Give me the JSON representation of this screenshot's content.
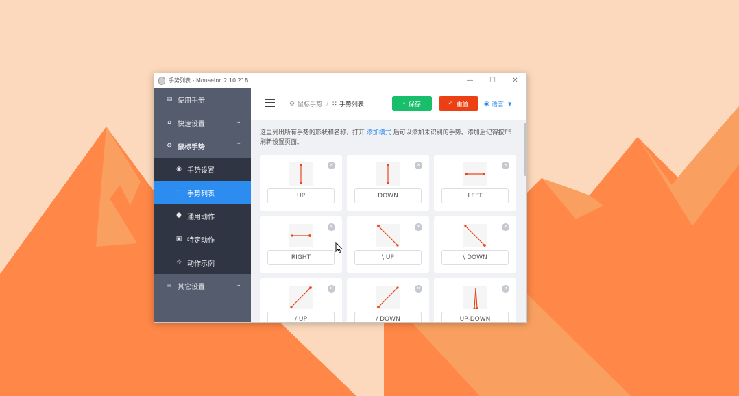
{
  "window": {
    "title": "手势列表 - MouseInc 2.10.21B",
    "controls": {
      "minimize": "—",
      "maximize": "☐",
      "close": "✕"
    }
  },
  "sidebar": {
    "items": [
      {
        "label": "使用手册",
        "icon": "book-icon"
      },
      {
        "label": "快速设置",
        "icon": "home-icon"
      },
      {
        "label": "鼠标手势",
        "icon": "gear-icon"
      },
      {
        "label": "手势设置",
        "icon": "palette-icon"
      },
      {
        "label": "手势列表",
        "icon": "grid-icon"
      },
      {
        "label": "通用动作",
        "icon": "cube-icon"
      },
      {
        "label": "特定动作",
        "icon": "briefcase-icon"
      },
      {
        "label": "动作示例",
        "icon": "bulb-icon"
      },
      {
        "label": "其它设置",
        "icon": "sliders-icon"
      }
    ]
  },
  "header": {
    "breadcrumb": [
      "鼠标手势",
      "手势列表"
    ],
    "breadcrumb_sep": "/",
    "save_label": "保存",
    "reset_label": "重置",
    "language_label": "语言"
  },
  "content": {
    "desc_part1": "这里列出所有手势的形状和名称，打开 ",
    "desc_link": "添加模式",
    "desc_part2": " 后可以添加未识别的手势。添加后记得按F5刷新设置页面。"
  },
  "gestures": [
    {
      "name": "UP",
      "shape": "up"
    },
    {
      "name": "DOWN",
      "shape": "down"
    },
    {
      "name": "LEFT",
      "shape": "left"
    },
    {
      "name": "RIGHT",
      "shape": "right"
    },
    {
      "name": "\\ UP",
      "shape": "bs-up"
    },
    {
      "name": "\\ DOWN",
      "shape": "bs-down"
    },
    {
      "name": "/ UP",
      "shape": "fs-up"
    },
    {
      "name": "/ DOWN",
      "shape": "fs-down"
    },
    {
      "name": "UP-DOWN",
      "shape": "up-down"
    }
  ],
  "colors": {
    "sidebar_bg": "#545c6d",
    "sidebar_sub_bg": "#2f3542",
    "active": "#2d8cf0",
    "save": "#19be6b",
    "reset": "#ed3f14",
    "gesture_stroke": "#e8471c"
  }
}
